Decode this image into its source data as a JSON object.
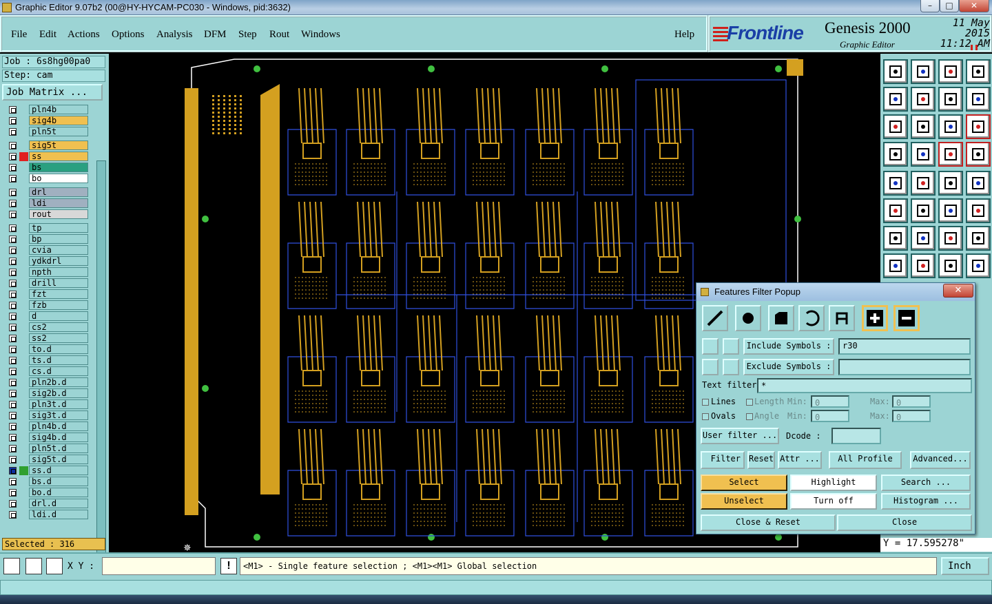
{
  "window": {
    "title": "Graphic Editor 9.07b2 (00@HY-HYCAM-PC030 - Windows, pid:3632)",
    "minimize": "–",
    "maximize": "□",
    "close": "✕"
  },
  "menu": {
    "items": [
      "File",
      "Edit",
      "Actions",
      "Options",
      "Analysis",
      "DFM",
      "Step",
      "Rout",
      "Windows"
    ],
    "help": "Help"
  },
  "branding": {
    "logo": "Frontline",
    "product": "Genesis 2000",
    "subtitle": "Graphic Editor",
    "date": "11 May 2015",
    "time": "11:12 AM",
    "accent": "#d0201a",
    "logo_color": "#1a3fa6"
  },
  "job": {
    "job_label": "Job : 6s8hg00pa0",
    "step_label": "Step: cam",
    "matrix_button": "Job Matrix ..."
  },
  "layers": [
    {
      "name": "pln4b",
      "color": "#9cd4d4"
    },
    {
      "name": "sig4b",
      "color": "#f0c050"
    },
    {
      "name": "pln5t",
      "color": "#9cd4d4"
    },
    {
      "name": "sig5t",
      "color": "#f0c050"
    },
    {
      "name": "ss",
      "color": "#f0c050",
      "mark": "#e02020"
    },
    {
      "name": "bs",
      "color": "#2aa080"
    },
    {
      "name": "bo",
      "color": "#ffffff"
    },
    {
      "name": "drl",
      "color": "#a0b0c0"
    },
    {
      "name": "ldi",
      "color": "#a0b0c0"
    },
    {
      "name": "rout",
      "color": "#d8d8d8"
    },
    {
      "name": "tp",
      "color": "#9cd4d4"
    },
    {
      "name": "bp",
      "color": "#9cd4d4"
    },
    {
      "name": "cvia",
      "color": "#9cd4d4"
    },
    {
      "name": "ydkdrl",
      "color": "#9cd4d4"
    },
    {
      "name": "npth",
      "color": "#9cd4d4"
    },
    {
      "name": "drill",
      "color": "#9cd4d4"
    },
    {
      "name": "fzt",
      "color": "#9cd4d4"
    },
    {
      "name": "fzb",
      "color": "#9cd4d4"
    },
    {
      "name": "d",
      "color": "#9cd4d4"
    },
    {
      "name": "cs2",
      "color": "#9cd4d4"
    },
    {
      "name": "ss2",
      "color": "#9cd4d4"
    },
    {
      "name": "to.d",
      "color": "#9cd4d4"
    },
    {
      "name": "ts.d",
      "color": "#9cd4d4"
    },
    {
      "name": "cs.d",
      "color": "#9cd4d4"
    },
    {
      "name": "pln2b.d",
      "color": "#9cd4d4"
    },
    {
      "name": "sig2b.d",
      "color": "#9cd4d4"
    },
    {
      "name": "pln3t.d",
      "color": "#9cd4d4"
    },
    {
      "name": "sig3t.d",
      "color": "#9cd4d4"
    },
    {
      "name": "pln4b.d",
      "color": "#9cd4d4"
    },
    {
      "name": "sig4b.d",
      "color": "#9cd4d4"
    },
    {
      "name": "pln5t.d",
      "color": "#9cd4d4"
    },
    {
      "name": "sig5t.d",
      "color": "#9cd4d4"
    },
    {
      "name": "ss.d",
      "color": "#9cd4d4",
      "active": true
    },
    {
      "name": "bs.d",
      "color": "#9cd4d4"
    },
    {
      "name": "bo.d",
      "color": "#9cd4d4"
    },
    {
      "name": "drl.d",
      "color": "#9cd4d4"
    },
    {
      "name": "ldi.d",
      "color": "#9cd4d4"
    }
  ],
  "selected": "Selected : 316",
  "readout": {
    "y": "Y = 17.595278\""
  },
  "status": {
    "xy_label": "X Y :",
    "message": "<M1> - Single feature selection ; <M1><M1> Global selection",
    "unit": "Inch"
  },
  "popup": {
    "title": "Features Filter Popup",
    "include_label": "Include Symbols :",
    "include_value": "r30",
    "exclude_label": "Exclude Symbols :",
    "exclude_value": "",
    "text_filter_label": "Text filter",
    "text_filter_value": "*",
    "lines": "Lines",
    "ovals": "Ovals",
    "length": "Length",
    "angle": "Angle",
    "min": "Min:",
    "max": "Max:",
    "zero": "0",
    "user_filter": "User filter ...",
    "dcode": "Dcode :",
    "filter": "Filter",
    "reset": "Reset",
    "attr": "Attr ...",
    "all_profile": "All Profile",
    "advanced": "Advanced...",
    "select": "Select",
    "highlight": "Highlight",
    "search": "Search ...",
    "unselect": "Unselect",
    "turn_off": "Turn off",
    "histogram": "Histogram ...",
    "close_reset": "Close & Reset",
    "close": "Close"
  },
  "tools": [
    "home-icon",
    "save-icon",
    "house-icon",
    "window-icon",
    "import-icon",
    "export-icon",
    "snap-icon",
    "grid-icon",
    "zoom-fit-icon",
    "zoom-pan-icon",
    "scale-icon",
    "help-icon",
    "ruler-icon",
    "grid2-icon",
    "measure-icon",
    "measure2-icon",
    "select-icon",
    "shape-icon",
    "ruler-scale-icon",
    "dot-icon",
    "connect-icon",
    "cross-icon",
    "arrow-icon",
    "arrow2-icon",
    "line-icon",
    "line2-icon",
    "rotate-icon",
    "mirror-icon",
    "move-icon",
    "stretch-icon",
    "copy-icon",
    "array-icon"
  ]
}
